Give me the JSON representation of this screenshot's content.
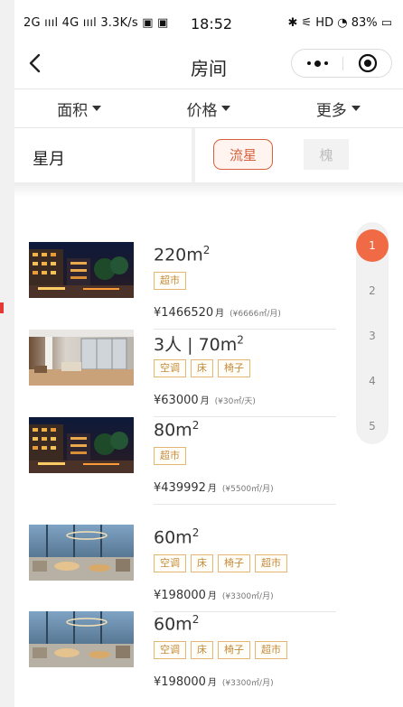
{
  "status_bar": {
    "left": "2G ıııl 4G ıııl 3.3K/s ▣ ▣",
    "time": "18:52",
    "right": "✱ ⚟ HD ◔ 83% ▭"
  },
  "nav": {
    "title": "房间",
    "back_icon": "chevron-left-icon",
    "more_icon": "more-dots-icon",
    "close_icon": "target-close-icon"
  },
  "filters": [
    {
      "label": "面积"
    },
    {
      "label": "价格"
    },
    {
      "label": "更多"
    }
  ],
  "building": {
    "name": "星月",
    "chips": [
      {
        "label": "流星",
        "active": true
      },
      {
        "label": "槐",
        "active": false
      }
    ]
  },
  "listings": [
    {
      "area_prefix": "",
      "area": "220m",
      "sup": "2",
      "tags": [
        "超市"
      ],
      "price": "¥1466520",
      "unit": "月",
      "rate": "(¥6666㎡/月)",
      "image": "night-street"
    },
    {
      "area_prefix": "3人 | ",
      "area": "70m",
      "sup": "2",
      "tags": [
        "空调",
        "床",
        "椅子"
      ],
      "price": "¥63000",
      "unit": "月",
      "rate": "(¥30㎡/天)",
      "image": "office-interior"
    },
    {
      "area_prefix": "",
      "area": "80m",
      "sup": "2",
      "tags": [
        "超市"
      ],
      "price": "¥439992",
      "unit": "月",
      "rate": "(¥5500㎡/月)",
      "image": "night-street"
    },
    {
      "area_prefix": "",
      "area": "60m",
      "sup": "2",
      "tags": [
        "空调",
        "床",
        "椅子",
        "超市"
      ],
      "price": "¥198000",
      "unit": "月",
      "rate": "(¥3300㎡/月)",
      "image": "lounge"
    },
    {
      "area_prefix": "",
      "area": "60m",
      "sup": "2",
      "tags": [
        "空调",
        "床",
        "椅子",
        "超市"
      ],
      "price": "¥198000",
      "unit": "月",
      "rate": "(¥3300㎡/月)",
      "image": "lounge"
    }
  ],
  "pager": {
    "pages": [
      "1",
      "2",
      "3",
      "4",
      "5"
    ],
    "active": "1"
  },
  "colors": {
    "accent": "#f06a45",
    "chip_border": "#d7603e",
    "tag_border": "#e4b674",
    "tag_text": "#c58b3a"
  }
}
